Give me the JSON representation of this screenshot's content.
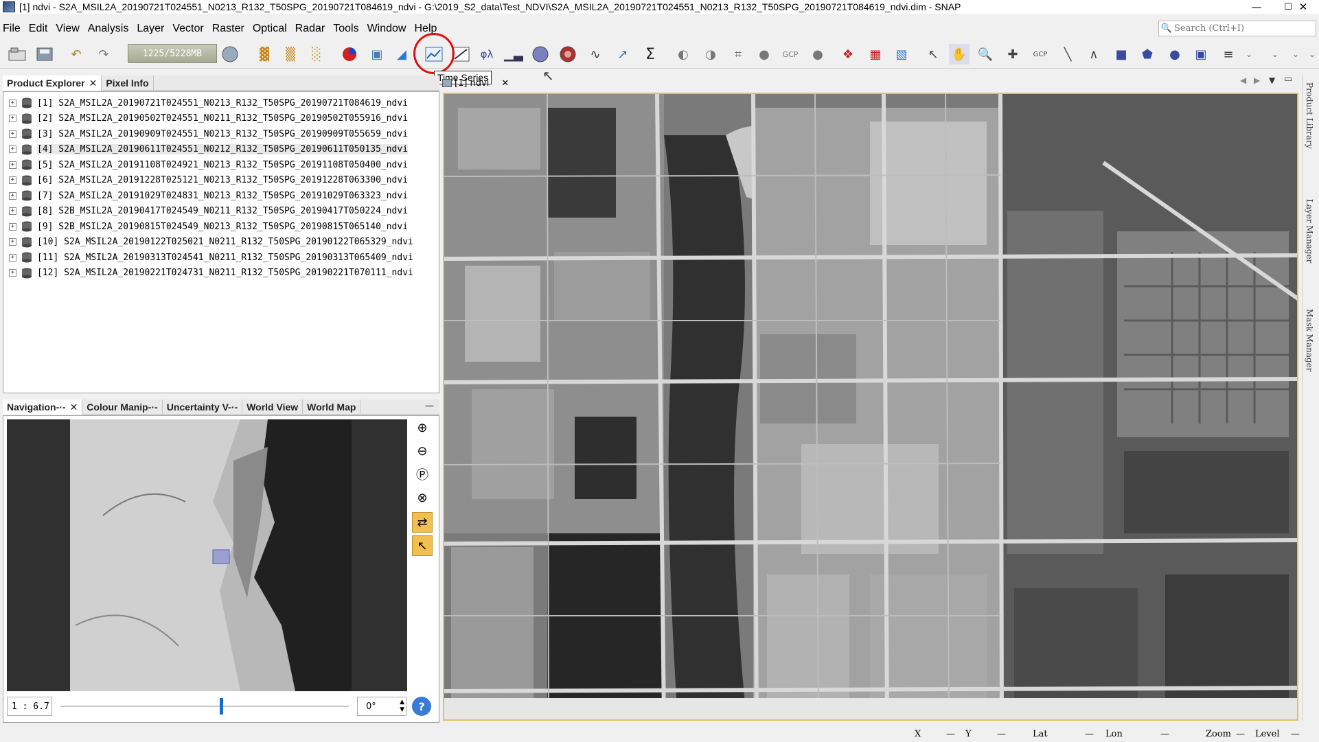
{
  "window": {
    "title": "[1] ndvi - S2A_MSIL2A_20190721T024551_N0213_R132_T50SPG_20190721T084619_ndvi - G:\\2019_S2_data\\Test_NDVI\\S2A_MSIL2A_20190721T024551_N0213_R132_T50SPG_20190721T084619_ndvi.dim - SNAP",
    "controls": [
      "—",
      "☐",
      "✕"
    ]
  },
  "menu": [
    "File",
    "Edit",
    "View",
    "Analysis",
    "Layer",
    "Vector",
    "Raster",
    "Optical",
    "Radar",
    "Tools",
    "Window",
    "Help"
  ],
  "search": {
    "placeholder": "Search (Ctrl+I)"
  },
  "toolbar": {
    "memory": "1225/5228MB",
    "tooltip": "Time Series"
  },
  "product_explorer": {
    "tabs": [
      {
        "label": "Product Explorer",
        "close": "✕"
      },
      {
        "label": "Pixel Info"
      }
    ],
    "items": [
      {
        "label": "[1]  S2A_MSIL2A_20190721T024551_N0213_R132_T50SPG_20190721T084619_ndvi"
      },
      {
        "label": "[2]  S2A_MSIL2A_20190502T024551_N0211_R132_T50SPG_20190502T055916_ndvi"
      },
      {
        "label": "[3]  S2A_MSIL2A_20190909T024551_N0213_R132_T50SPG_20190909T055659_ndvi"
      },
      {
        "label": "[4]  S2A_MSIL2A_20190611T024551_N0212_R132_T50SPG_20190611T050135_ndvi"
      },
      {
        "label": "[5]  S2A_MSIL2A_20191108T024921_N0213_R132_T50SPG_20191108T050400_ndvi"
      },
      {
        "label": "[6]  S2A_MSIL2A_20191228T025121_N0213_R132_T50SPG_20191228T063300_ndvi"
      },
      {
        "label": "[7]  S2A_MSIL2A_20191029T024831_N0213_R132_T50SPG_20191029T063323_ndvi"
      },
      {
        "label": "[8]  S2B_MSIL2A_20190417T024549_N0211_R132_T50SPG_20190417T050224_ndvi"
      },
      {
        "label": "[9]  S2B_MSIL2A_20190815T024549_N0213_R132_T50SPG_20190815T065140_ndvi"
      },
      {
        "label": "[10]  S2A_MSIL2A_20190122T025021_N0211_R132_T50SPG_20190122T065329_ndvi"
      },
      {
        "label": "[11]  S2A_MSIL2A_20190313T024541_N0211_R132_T50SPG_20190313T065409_ndvi"
      },
      {
        "label": "[12]  S2A_MSIL2A_20190221T024731_N0211_R132_T50SPG_20190221T070111_ndvi"
      }
    ]
  },
  "navigation": {
    "tabs": [
      {
        "label": "Navigation-·-",
        "close": "✕"
      },
      {
        "label": "Colour Manip-·-"
      },
      {
        "label": "Uncertainty V-·-"
      },
      {
        "label": "World View"
      },
      {
        "label": "World Map"
      }
    ],
    "minimize": "—",
    "scale": "1 : 6.7",
    "angle": "0°",
    "help": "?"
  },
  "image_view": {
    "tab_label": "[1] ndvi",
    "close": "✕"
  },
  "right_sidebar": [
    "Product Library",
    "Layer Manager",
    "Mask Manager"
  ],
  "status": {
    "x_label": "X",
    "x_value": "—",
    "y_label": "Y",
    "y_value": "—",
    "lat_label": "Lat",
    "lat_value": "—",
    "lon_label": "Lon",
    "lon_value": "—",
    "zoom_label": "Zoom",
    "zoom_value": "—",
    "level_label": "Level",
    "level_value": "—"
  }
}
